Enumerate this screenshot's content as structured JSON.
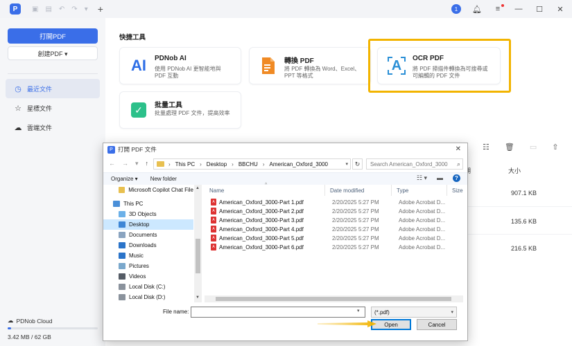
{
  "titlebar": {
    "logo_letter": "P",
    "user_badge": "1",
    "icons": [
      "save-icon",
      "undo-icon",
      "redo-icon",
      "dropdown-icon",
      "plus-icon",
      "bell-icon",
      "menu-icon",
      "minimize-icon",
      "maximize-icon",
      "close-icon"
    ]
  },
  "sidebar": {
    "open_pdf": "打開PDF",
    "create_pdf": "創建PDF ▾",
    "nav": [
      {
        "label": "最近文件",
        "icon": "clock-icon",
        "active": true
      },
      {
        "label": "星標文件",
        "icon": "star-icon",
        "active": false
      },
      {
        "label": "雲端文件",
        "icon": "cloud-icon",
        "active": false
      }
    ],
    "cloud_title": "PDNob Cloud",
    "cloud_usage": "3.42 MB  /  62 GB",
    "cloud_fraction": 0.04
  },
  "main": {
    "quick_tools_title": "快捷工具",
    "cards": [
      {
        "title": "PDNob AI",
        "icon_text": "AI",
        "desc": "使用 PDNob AI 更智能地與 PDF 互動"
      },
      {
        "title": "轉換 PDF",
        "icon_text": "",
        "desc": "將 PDF 轉換為 Word、Excel、PPT 等格式"
      },
      {
        "title": "OCR PDF",
        "icon_text": "A",
        "desc": "將 PDF 掃描件轉換為可搜尋或可編輯的 PDF 文件"
      },
      {
        "title": "批量工具",
        "icon_text": "✓",
        "desc": "批量處理 PDF 文件，提高效率"
      }
    ],
    "col_partial": "期",
    "col_size": "大小",
    "file_sizes": [
      "907.1 KB",
      "135.6 KB",
      "216.5 KB"
    ]
  },
  "dialog": {
    "title": "打開 PDF 文件",
    "breadcrumb": [
      "This PC",
      "Desktop",
      "BBCHU",
      "American_Oxford_3000"
    ],
    "search_placeholder": "Search American_Oxford_3000",
    "organize": "Organize ▾",
    "new_folder": "New folder",
    "tree": [
      {
        "label": "Microsoft Copilot Chat File",
        "color": "#e8c050",
        "selected": false
      },
      {
        "label": "This PC",
        "color": "#4a8fd8",
        "selected": false
      },
      {
        "label": "3D Objects",
        "color": "#6bb0e8",
        "selected": false
      },
      {
        "label": "Desktop",
        "color": "#3d86d6",
        "selected": true
      },
      {
        "label": "Documents",
        "color": "#8aa4c0",
        "selected": false
      },
      {
        "label": "Downloads",
        "color": "#2b74c9",
        "selected": false
      },
      {
        "label": "Music",
        "color": "#2b74c9",
        "selected": false
      },
      {
        "label": "Pictures",
        "color": "#7aa8cc",
        "selected": false
      },
      {
        "label": "Videos",
        "color": "#555c66",
        "selected": false
      },
      {
        "label": "Local Disk (C:)",
        "color": "#8a929c",
        "selected": false
      },
      {
        "label": "Local Disk (D:)",
        "color": "#8a929c",
        "selected": false
      }
    ],
    "columns": {
      "name": "Name",
      "date": "Date modified",
      "type": "Type",
      "size": "Size"
    },
    "files": [
      {
        "name": "American_Oxford_3000-Part 1.pdf",
        "date": "2/20/2025 5:27 PM",
        "type": "Adobe Acrobat D..."
      },
      {
        "name": "American_Oxford_3000-Part 2.pdf",
        "date": "2/20/2025 5:27 PM",
        "type": "Adobe Acrobat D..."
      },
      {
        "name": "American_Oxford_3000-Part 3.pdf",
        "date": "2/20/2025 5:27 PM",
        "type": "Adobe Acrobat D..."
      },
      {
        "name": "American_Oxford_3000-Part 4.pdf",
        "date": "2/20/2025 5:27 PM",
        "type": "Adobe Acrobat D..."
      },
      {
        "name": "American_Oxford_3000-Part 5.pdf",
        "date": "2/20/2025 5:27 PM",
        "type": "Adobe Acrobat D..."
      },
      {
        "name": "American_Oxford_3000-Part 6.pdf",
        "date": "2/20/2025 5:27 PM",
        "type": "Adobe Acrobat D..."
      }
    ],
    "file_name_label": "File name:",
    "file_name_value": "",
    "filter": "(*.pdf)",
    "open": "Open",
    "cancel": "Cancel"
  },
  "colors": {
    "accent": "#3a6ee8",
    "highlight": "#f2b400",
    "pdf_red": "#d33333"
  }
}
